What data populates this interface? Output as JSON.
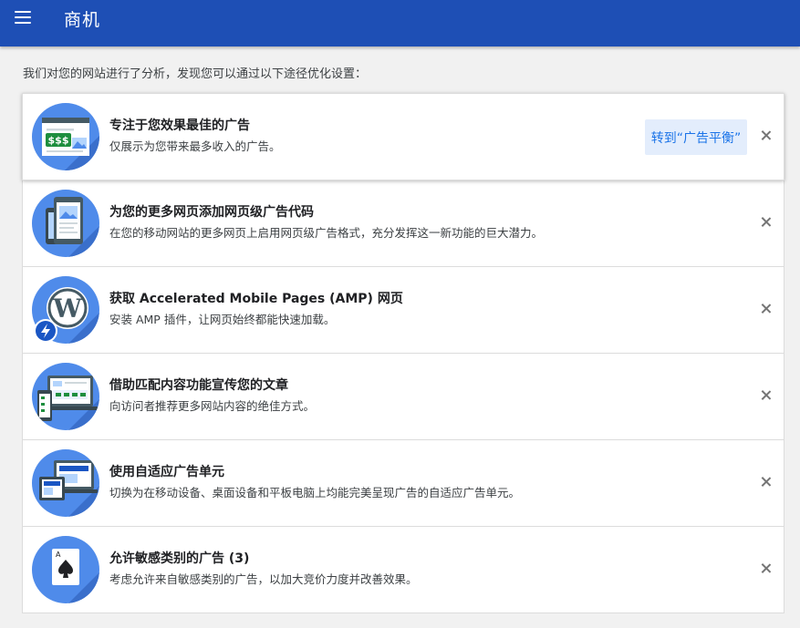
{
  "app": {
    "title": "商机"
  },
  "intro": "我们对您的网站进行了分析，发现您可以通过以下途径优化设置：",
  "cards": [
    {
      "title": "专注于您效果最佳的广告",
      "desc": "仅展示为您带来最多收入的广告。",
      "cta": "转到“广告平衡”",
      "icon": "ad-dollar-icon"
    },
    {
      "title": "为您的更多网页添加网页级广告代码",
      "desc": "在您的移动网站的更多网页上启用网页级广告格式，充分发挥这一新功能的巨大潜力。",
      "icon": "mobile-page-icon"
    },
    {
      "title": "获取 Accelerated Mobile Pages (AMP) 网页",
      "desc": "安装 AMP 插件，让网页始终都能快速加载。",
      "icon": "wordpress-amp-icon"
    },
    {
      "title": "借助匹配内容功能宣传您的文章",
      "desc": "向访问者推荐更多网站内容的绝佳方式。",
      "icon": "matched-content-icon"
    },
    {
      "title": "使用自适应广告单元",
      "desc": "切换为在移动设备、桌面设备和平板电脑上均能完美呈现广告的自适应广告单元。",
      "icon": "responsive-devices-icon"
    },
    {
      "title": "允许敏感类别的广告 (3)",
      "desc": "考虑允许来自敏感类别的广告，以加大竞价力度并改善效果。",
      "icon": "playing-card-icon"
    }
  ],
  "colors": {
    "appbar": "#1e4fb5",
    "icon_circle": "#4f8bea",
    "cta_bg": "#e3edfc",
    "cta_text": "#1a73e8"
  }
}
